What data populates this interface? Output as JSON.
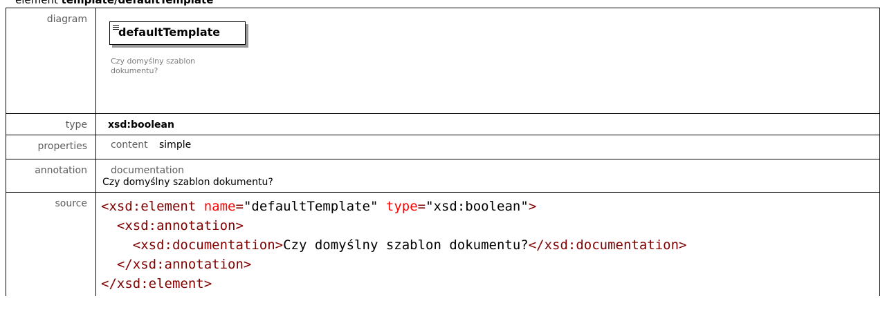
{
  "header": {
    "prefix": "element",
    "path": "template/defaultTemplate"
  },
  "rows": {
    "diagram": {
      "label": "diagram",
      "element_name": "defaultTemplate",
      "note": "Czy domyślny szablon dokumentu?"
    },
    "type": {
      "label": "type",
      "value": "xsd:boolean"
    },
    "properties": {
      "label": "properties",
      "key": "content",
      "value": "simple"
    },
    "annotation": {
      "label": "annotation",
      "key": "documentation",
      "value": "Czy domyślny szablon dokumentu?"
    },
    "source": {
      "label": "source",
      "line1": {
        "open": "<xsd:element",
        "attr1_name": "name",
        "attr1_value": "\"defaultTemplate\"",
        "attr2_name": "type",
        "attr2_value": "\"xsd:boolean\"",
        "close": ">"
      },
      "line2": "<xsd:annotation>",
      "line3": {
        "open": "<xsd:documentation>",
        "text": "Czy domyślny szablon dokumentu?",
        "close": "</xsd:documentation>"
      },
      "line4": "</xsd:annotation>",
      "line5": "</xsd:element>"
    }
  },
  "colors": {
    "tag": "#800000",
    "attribute": "#ff0000",
    "label": "#5c5c5c",
    "note": "#7a7a7a"
  }
}
